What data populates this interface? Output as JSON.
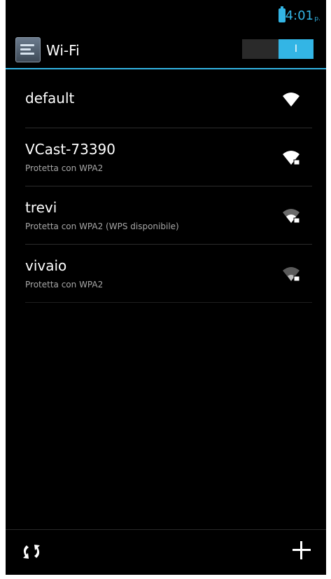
{
  "status_bar": {
    "time": "4:01",
    "ampm": "p."
  },
  "action_bar": {
    "title": "Wi-Fi",
    "toggle_label": "I"
  },
  "networks": [
    {
      "ssid": "default",
      "subtitle": ""
    },
    {
      "ssid": "VCast-73390",
      "subtitle": "Protetta con WPA2"
    },
    {
      "ssid": "trevi",
      "subtitle": "Protetta con WPA2 (WPS disponibile)"
    },
    {
      "ssid": "vivaio",
      "subtitle": "Protetta con WPA2"
    }
  ],
  "bottom_bar": {
    "scan_icon": "refresh-icon",
    "add_icon": "add-icon"
  },
  "colors": {
    "accent": "#33b5e5",
    "background": "#000000",
    "secondary_text": "#a7a7a7"
  }
}
